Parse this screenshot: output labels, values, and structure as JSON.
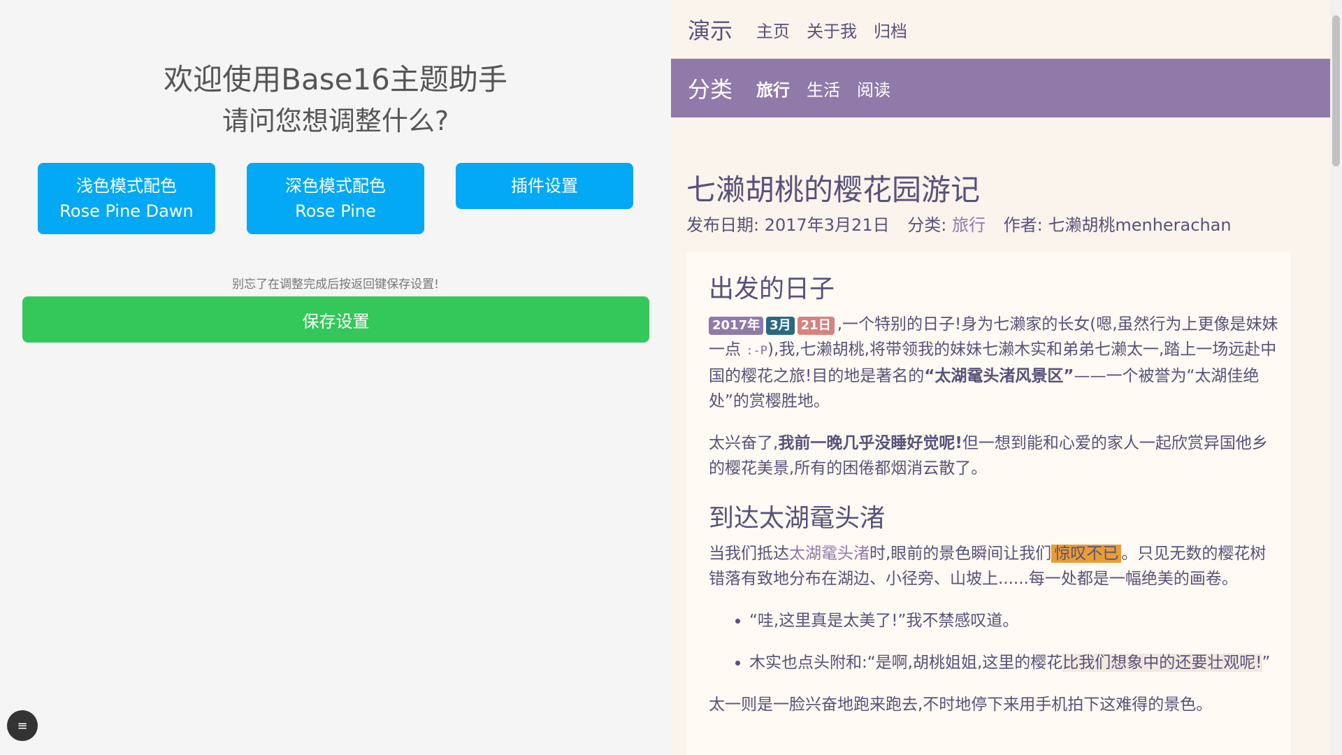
{
  "left": {
    "welcome": "欢迎使用Base16主题助手",
    "question": "请问您想调整什么?",
    "buttons": {
      "light_line1": "浅色模式配色",
      "light_line2": "Rose Pine Dawn",
      "dark_line1": "深色模式配色",
      "dark_line2": "Rose Pine",
      "plugin": "插件设置"
    },
    "reminder": "别忘了在调整完成后按返回键保存设置!",
    "save": "保存设置",
    "menu_glyph": "≡"
  },
  "topnav": {
    "brand": "演示",
    "links": [
      "主页",
      "关于我",
      "归档"
    ]
  },
  "catnav": {
    "brand": "分类",
    "links": [
      "旅行",
      "生活",
      "阅读"
    ]
  },
  "post": {
    "title": "七濑胡桃的樱花园游记",
    "meta_date_label": "发布日期: 2017年3月21日",
    "meta_cat_label": "分类:",
    "meta_cat": "旅行",
    "meta_author": "作者: 七濑胡桃menherachan",
    "section1_title": "出发的日子",
    "badge_year": "2017年",
    "badge_month": "3月",
    "badge_day": "21日",
    "p1_a": ",一个特别的日子!身为七濑家的长女(嗯,虽然行为上更像是妹妹一点 ",
    "p1_code": ":-P",
    "p1_b": "),我,七濑胡桃,将带领我的妹妹七濑木实和弟弟七濑太一,踏上一场远赴中国的樱花之旅!目的地是著名的",
    "p1_strong": "“太湖鼋头渚风景区”",
    "p1_c": "——一个被誉为“太湖佳绝处”的赏樱胜地。",
    "p2_a": "太兴奋了,",
    "p2_strong": "我前一晚几乎没睡好觉呢!",
    "p2_b": "但一想到能和心爱的家人一起欣赏异国他乡的樱花美景,所有的困倦都烟消云散了。",
    "section2_title": "到达太湖鼋头渚",
    "p3_a": "当我们抵达",
    "p3_link": "太湖鼋头渚",
    "p3_b": "时,眼前的景色瞬间让我们",
    "p3_hl": "惊叹不已",
    "p3_c": "。只见无数的樱花树错落有致地分布在湖边、小径旁、山坡上......每一处都是一幅绝美的画卷。",
    "q1": "“哇,这里真是太美了!”我不禁感叹道。",
    "q2_a": "木实也点头附和:“是啊,胡桃姐姐,这里的樱花",
    "q2_mark": "比我们想象中的还要壮观呢!",
    "q2_b": "”",
    "p4": "太一则是一脸兴奋地跑来跑去,不时地停下来用手机拍下这难得的景色。"
  }
}
